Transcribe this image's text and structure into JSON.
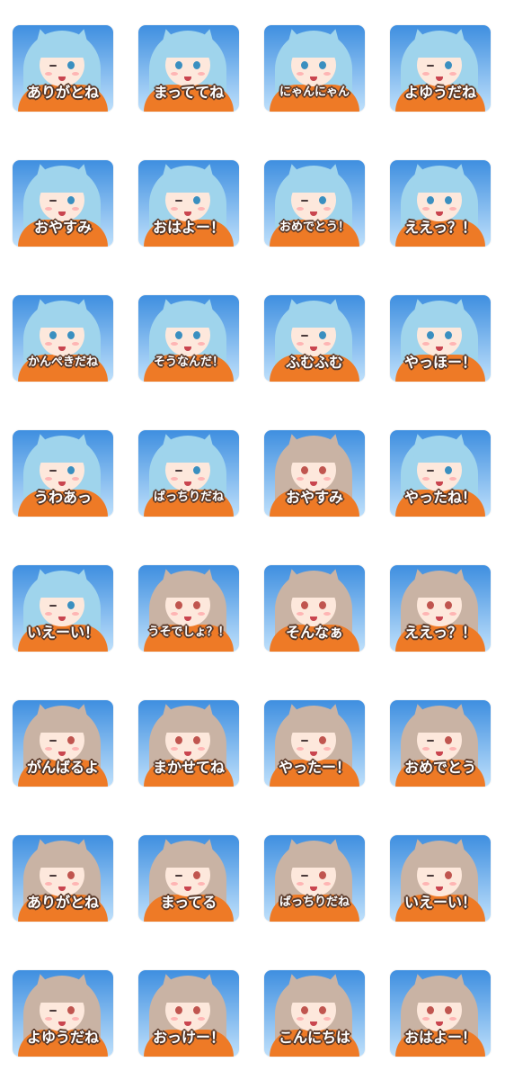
{
  "colors": {
    "sky_top": "#3f8fe0",
    "sky_bottom": "#bfe0fb",
    "blue_hair": "#9fd4ec",
    "blue_eye": "#3a8fc0",
    "brown_hair": "#c9b3a4",
    "brown_eye": "#c0554f",
    "hoodie": "#ee7a26",
    "caption_outline": "#5a3a2a"
  },
  "stickers": [
    {
      "label": "ありがとね",
      "hair": "blue",
      "expr": "wink"
    },
    {
      "label": "まっててね",
      "hair": "blue",
      "expr": "open"
    },
    {
      "label": "にゃんにゃん",
      "hair": "blue",
      "expr": "open"
    },
    {
      "label": "よゆうだね",
      "hair": "blue",
      "expr": "wink"
    },
    {
      "label": "おやすみ",
      "hair": "blue",
      "expr": "wink"
    },
    {
      "label": "おはよー！",
      "hair": "blue",
      "expr": "wink"
    },
    {
      "label": "おめでとう！",
      "hair": "blue",
      "expr": "wink"
    },
    {
      "label": "ええっ？！",
      "hair": "blue",
      "expr": "open"
    },
    {
      "label": "かんぺきだね",
      "hair": "blue",
      "expr": "open"
    },
    {
      "label": "そうなんだ！",
      "hair": "blue",
      "expr": "open"
    },
    {
      "label": "ふむふむ",
      "hair": "blue",
      "expr": "wink"
    },
    {
      "label": "やっほー！",
      "hair": "blue",
      "expr": "open"
    },
    {
      "label": "うわあっ",
      "hair": "blue",
      "expr": "wink"
    },
    {
      "label": "ばっちりだね",
      "hair": "blue",
      "expr": "wink"
    },
    {
      "label": "おやすみ",
      "hair": "brown",
      "expr": "open"
    },
    {
      "label": "やったね！",
      "hair": "blue",
      "expr": "wink"
    },
    {
      "label": "いえーい！",
      "hair": "blue",
      "expr": "wink"
    },
    {
      "label": "うそでしょ？！",
      "hair": "brown",
      "expr": "open"
    },
    {
      "label": "そんなぁ",
      "hair": "brown",
      "expr": "open"
    },
    {
      "label": "ええっ？！",
      "hair": "brown",
      "expr": "open"
    },
    {
      "label": "がんばるよ",
      "hair": "brown",
      "expr": "wink"
    },
    {
      "label": "まかせてね",
      "hair": "brown",
      "expr": "open"
    },
    {
      "label": "やったー！",
      "hair": "brown",
      "expr": "wink"
    },
    {
      "label": "おめでとう",
      "hair": "brown",
      "expr": "wink"
    },
    {
      "label": "ありがとね",
      "hair": "brown",
      "expr": "wink"
    },
    {
      "label": "まってる",
      "hair": "brown",
      "expr": "wink"
    },
    {
      "label": "ばっちりだね",
      "hair": "brown",
      "expr": "wink"
    },
    {
      "label": "いえーい！",
      "hair": "brown",
      "expr": "wink"
    },
    {
      "label": "よゆうだね",
      "hair": "brown",
      "expr": "wink"
    },
    {
      "label": "おっけー！",
      "hair": "brown",
      "expr": "open"
    },
    {
      "label": "こんにちは",
      "hair": "brown",
      "expr": "open"
    },
    {
      "label": "おはよー！",
      "hair": "brown",
      "expr": "open"
    }
  ]
}
